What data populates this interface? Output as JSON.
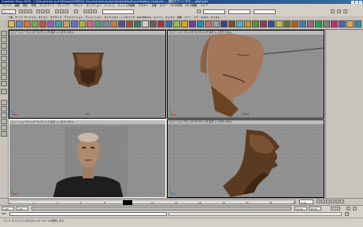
{
  "window": {
    "title": "Autodesk Maya 2008 - C:\\Documents and Settings\\HARD\\My Documents\\maya\\projects\\default\\scenes\\face_head.mb --- 頭部モデリング中 --- pSphere1"
  },
  "menubar": {
    "items": [
      "ファイル",
      "編集",
      "修正",
      "作成",
      "ディスプレイ",
      "ウィンドウ",
      "アセット",
      "セレクション",
      "メッシュ",
      "メッシュの編集",
      "プロキシ",
      "法線",
      "カラー",
      "UV の作成",
      "UV の編集",
      "ヘルプ"
    ]
  },
  "statusline": {
    "mode": "ポリゴン"
  },
  "shelf": {
    "tabs": [
      "一般",
      "カーブ",
      "サーフェス",
      "ポリゴン",
      "サブディブ",
      "デフォメーション",
      "アニメーション",
      "ダイナミクス",
      "レンダリング",
      "PaintEffects",
      "トゥーン",
      "マッスル",
      "流体",
      "ファー",
      "ヘア",
      "nCloth",
      "カスタム"
    ]
  },
  "viewports": [
    {
      "name": "top",
      "menu": "ビュー シェーディング ライティング 表示 レンダラ パネル",
      "label": "top"
    },
    {
      "name": "persp",
      "menu": "ビュー シェーディング ライティング 表示 レンダラ パネル",
      "label": "persp"
    },
    {
      "name": "front",
      "menu": "ビュー シェーディング ライティング 表示 レンダラ パネル",
      "label": "front"
    },
    {
      "name": "side",
      "menu": "ビュー シェーディング ライティング 表示 レンダラ パネル",
      "label": "side"
    }
  ],
  "timeslider": {
    "ticks": [
      "1",
      "2",
      "4",
      "6",
      "8",
      "10",
      "12",
      "14",
      "16",
      "18",
      "20",
      "22",
      "24"
    ],
    "current_frame": "1.00"
  },
  "range": {
    "start": "1.00",
    "end": "24.00",
    "anim_start": "1.00",
    "anim_end": "48.00"
  },
  "cmdline": {
    "label": "MEL",
    "value": ""
  },
  "helpline": {
    "text": "ヘルプ: オブジェクトまたはコンポーネントを選択します。"
  }
}
